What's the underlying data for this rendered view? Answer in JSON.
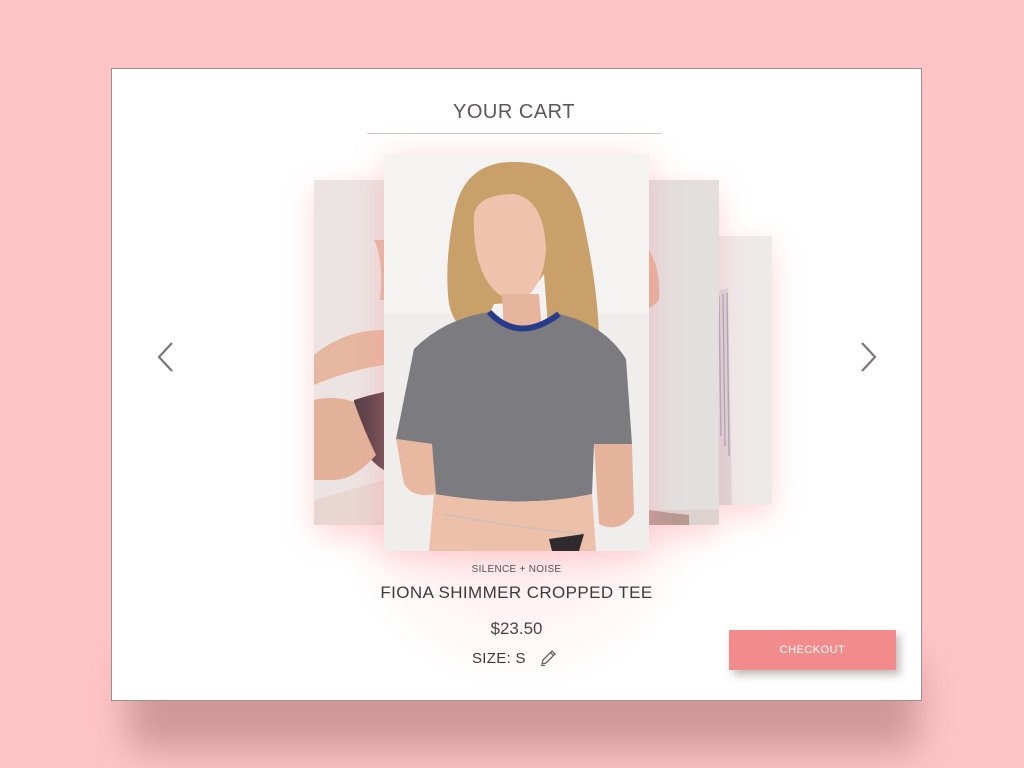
{
  "cart": {
    "title": "YOUR CART",
    "product": {
      "brand": "SILENCE + NOISE",
      "name": "FIONA SHIMMER CROPPED TEE",
      "price": "$23.50",
      "size_label": "SIZE: S"
    },
    "carousel": {
      "prev_icon": "chevron-left-icon",
      "next_icon": "chevron-right-icon"
    },
    "checkout_label": "CHECKOUT"
  },
  "colors": {
    "background": "#ffc4c6",
    "accent": "#f28b8c",
    "card": "#ffffff"
  }
}
